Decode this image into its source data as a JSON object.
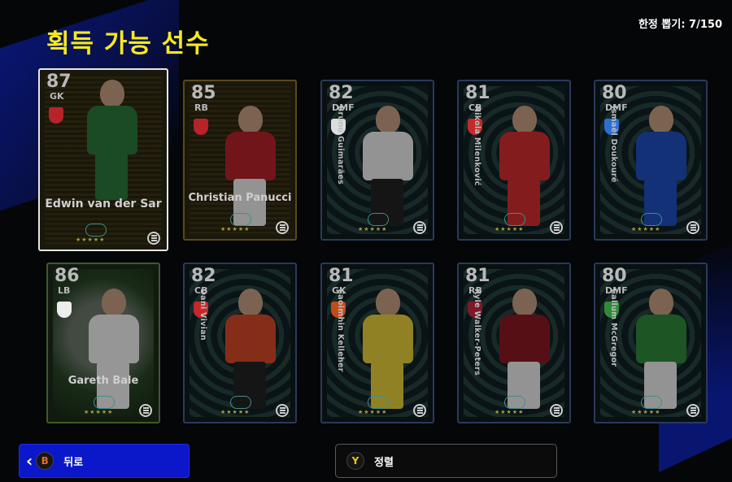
{
  "header": {
    "title": "획득 가능 선수",
    "limit_label": "한정 뽑기: 7/150"
  },
  "cards": [
    {
      "rating": "87",
      "position": "GK",
      "name": "Edwin van der Sar",
      "name_style": "horizontal",
      "kind": "selected",
      "crest_color": "#b8232a",
      "kit": "#2d7a3a",
      "shorts": "#2d7a3a"
    },
    {
      "rating": "85",
      "position": "RB",
      "name": "Christian Panucci",
      "name_style": "horizontal",
      "kind": "gold",
      "crest_color": "#b8232a",
      "kit": "#b8232a",
      "shorts": "#eeeeee"
    },
    {
      "rating": "82",
      "position": "DMF",
      "name": "Bruno Guimarães",
      "name_style": "vertical",
      "kind": "base",
      "crest_color": "#dddddd",
      "kit": "#eeeeee",
      "shorts": "#222222"
    },
    {
      "rating": "81",
      "position": "CB",
      "name": "Nikola Milenković",
      "name_style": "vertical",
      "kind": "base",
      "crest_color": "#c42a2a",
      "kit": "#d32f2f",
      "shorts": "#d32f2f"
    },
    {
      "rating": "80",
      "position": "DMF",
      "name": "Ismaël Doukouré",
      "name_style": "vertical",
      "kind": "base",
      "crest_color": "#2d6fd1",
      "kit": "#1f4fbf",
      "shorts": "#1f4fbf"
    },
    {
      "rating": "86",
      "position": "LB",
      "name": "Gareth Bale",
      "name_style": "horizontal",
      "kind": "green",
      "crest_color": "#eeeeee",
      "kit": "#f2f2f2",
      "shorts": "#f2f2f2"
    },
    {
      "rating": "82",
      "position": "CB",
      "name": "Dani Vivian",
      "name_style": "vertical",
      "kind": "base",
      "crest_color": "#c42a2a",
      "kit": "#d84a2a",
      "shorts": "#222222"
    },
    {
      "rating": "81",
      "position": "GK",
      "name": "Caoimhin Kelleher",
      "name_style": "vertical",
      "kind": "base",
      "crest_color": "#c24a1a",
      "kit": "#e8d23a",
      "shorts": "#e8d23a"
    },
    {
      "rating": "81",
      "position": "RB",
      "name": "Kyle Walker-Peters",
      "name_style": "vertical",
      "kind": "base",
      "crest_color": "#7a1a2a",
      "kit": "#8c1a22",
      "shorts": "#eeeeee"
    },
    {
      "rating": "80",
      "position": "DMF",
      "name": "Callum McGregor",
      "name_style": "vertical",
      "kind": "base",
      "crest_color": "#2f8a3a",
      "kit": "#2f8a3a",
      "shorts": "#eeeeee"
    }
  ],
  "stars": "★★★★★",
  "footer": {
    "back_button_key": "B",
    "back_label": "뒤로",
    "sort_button_key": "Y",
    "sort_label": "정렬"
  }
}
